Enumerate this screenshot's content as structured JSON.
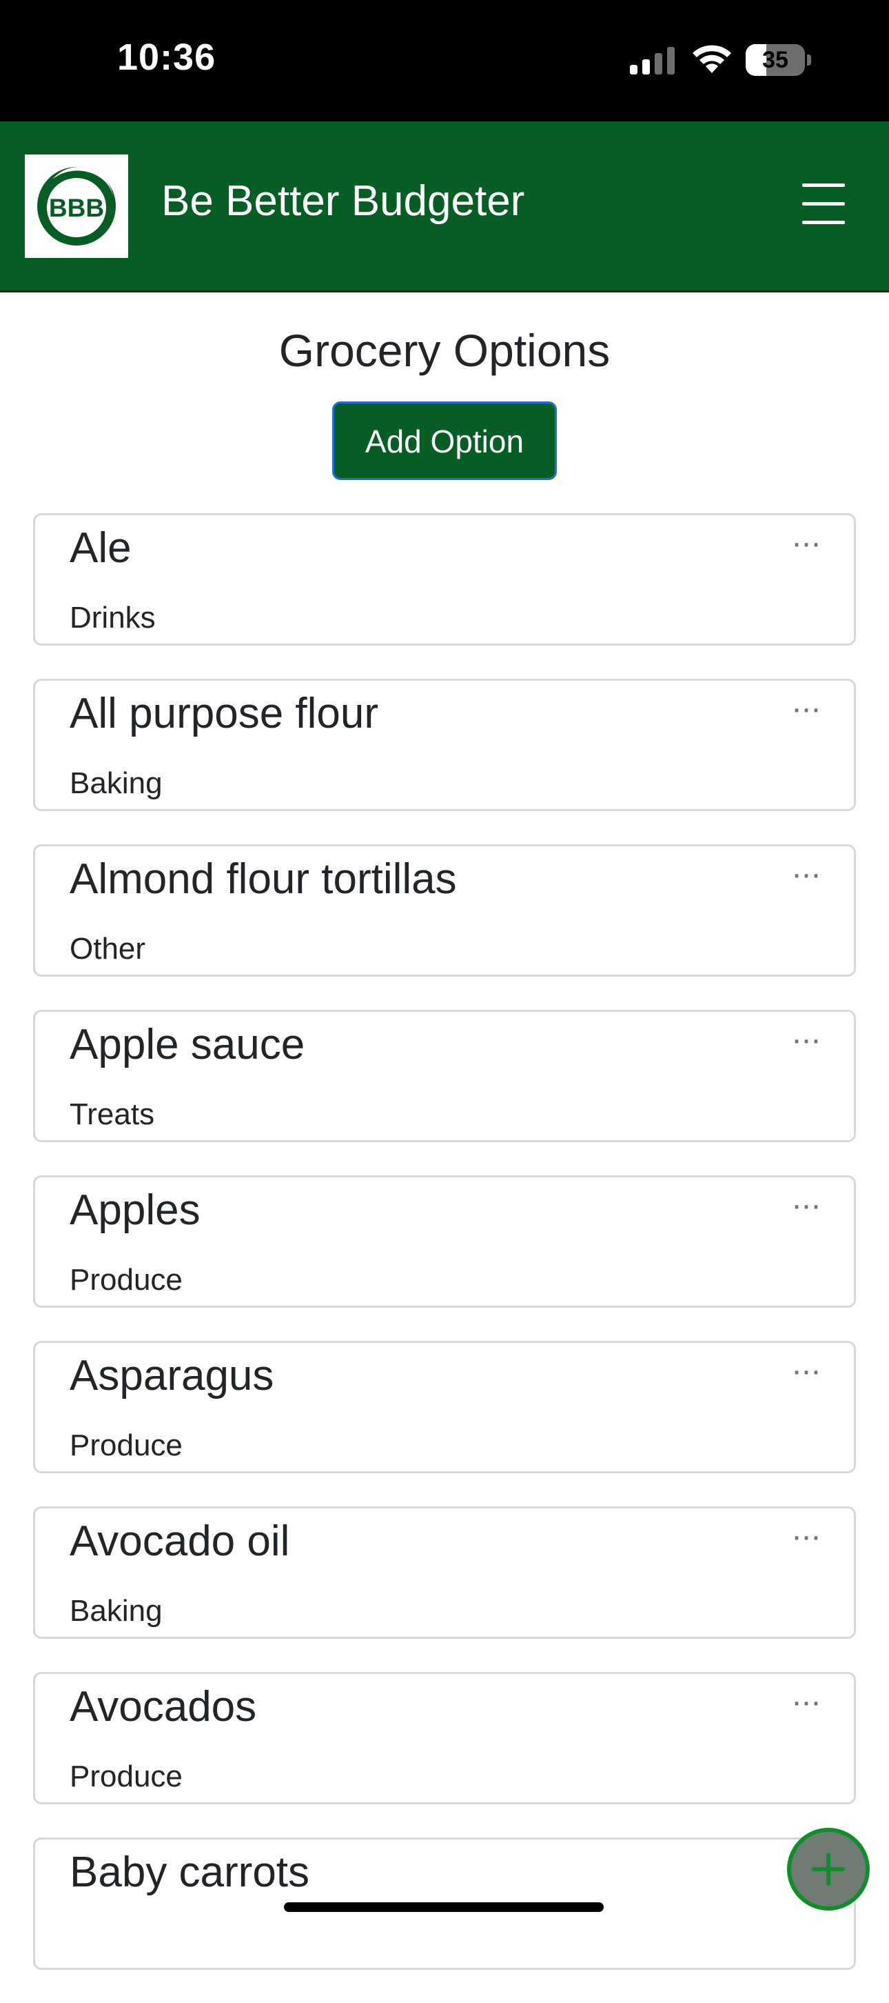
{
  "status_bar": {
    "time": "10:36",
    "battery_level": "35",
    "battery_fraction": 0.35
  },
  "navbar": {
    "logo_text": "BBB",
    "brand": "Be Better Budgeter"
  },
  "main": {
    "title": "Grocery Options",
    "add_button_label": "Add Option",
    "options": [
      {
        "name": "Ale",
        "category": "Drinks"
      },
      {
        "name": "All purpose flour",
        "category": "Baking"
      },
      {
        "name": "Almond flour tortillas",
        "category": "Other"
      },
      {
        "name": "Apple sauce",
        "category": "Treats"
      },
      {
        "name": "Apples",
        "category": "Produce"
      },
      {
        "name": "Asparagus",
        "category": "Produce"
      },
      {
        "name": "Avocado oil",
        "category": "Baking"
      },
      {
        "name": "Avocados",
        "category": "Produce"
      },
      {
        "name": "Baby carrots",
        "category": ""
      }
    ],
    "item_menu_glyph": "···"
  },
  "colors": {
    "brand_green": "#075e25",
    "button_border": "#1e6fd9",
    "fab_border": "#0e8f2a"
  }
}
